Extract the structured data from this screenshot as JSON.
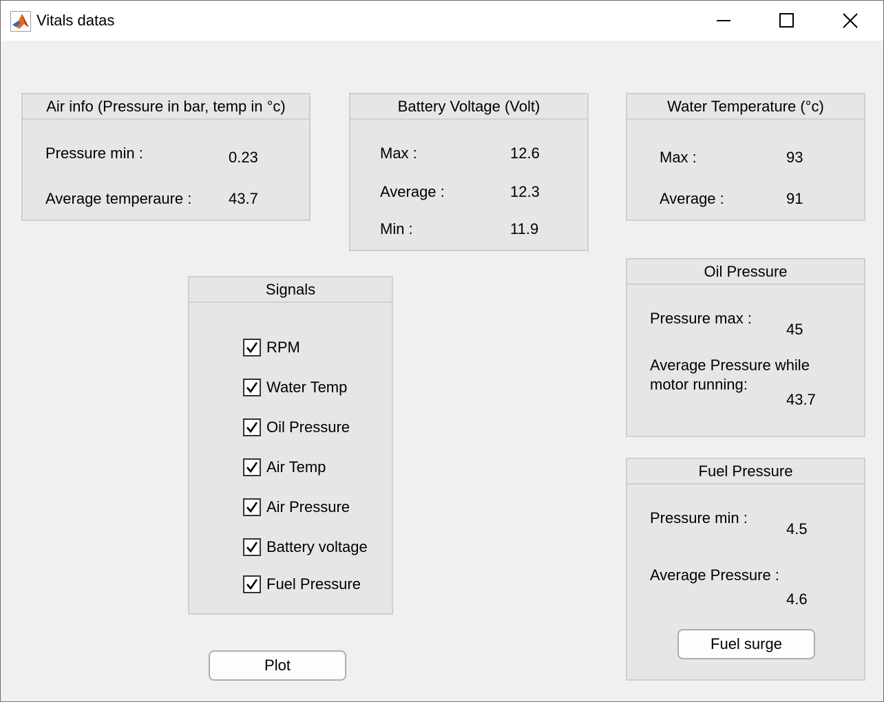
{
  "window": {
    "title": "Vitals datas",
    "icon": "matlab-icon"
  },
  "air_panel": {
    "title": "Air info (Pressure in bar, temp in °c)",
    "pressure_min_label": "Pressure min :",
    "pressure_min_value": "0.23",
    "avg_temp_label": "Average temperaure :",
    "avg_temp_value": "43.7"
  },
  "battery_panel": {
    "title": "Battery Voltage (Volt)",
    "max_label": "Max :",
    "max_value": "12.6",
    "avg_label": "Average :",
    "avg_value": "12.3",
    "min_label": "Min :",
    "min_value": "11.9"
  },
  "water_panel": {
    "title": "Water Temperature (°c)",
    "max_label": "Max :",
    "max_value": "93",
    "avg_label": "Average :",
    "avg_value": "91"
  },
  "oil_panel": {
    "title": "Oil Pressure",
    "max_label": "Pressure max :",
    "max_value": "45",
    "avg_label_line1": "Average Pressure while",
    "avg_label_line2": "motor running:",
    "avg_value": "43.7"
  },
  "fuel_panel": {
    "title": "Fuel Pressure",
    "min_label": "Pressure min :",
    "min_value": "4.5",
    "avg_label": "Average Pressure :",
    "avg_value": "4.6",
    "surge_button": "Fuel surge"
  },
  "signals_panel": {
    "title": "Signals",
    "items": [
      {
        "label": "RPM",
        "checked": true
      },
      {
        "label": "Water Temp",
        "checked": true
      },
      {
        "label": "Oil Pressure",
        "checked": true
      },
      {
        "label": "Air Temp",
        "checked": true
      },
      {
        "label": "Air Pressure",
        "checked": true
      },
      {
        "label": "Battery voltage",
        "checked": true
      },
      {
        "label": "Fuel Pressure",
        "checked": true
      }
    ]
  },
  "plot_button": "Plot"
}
